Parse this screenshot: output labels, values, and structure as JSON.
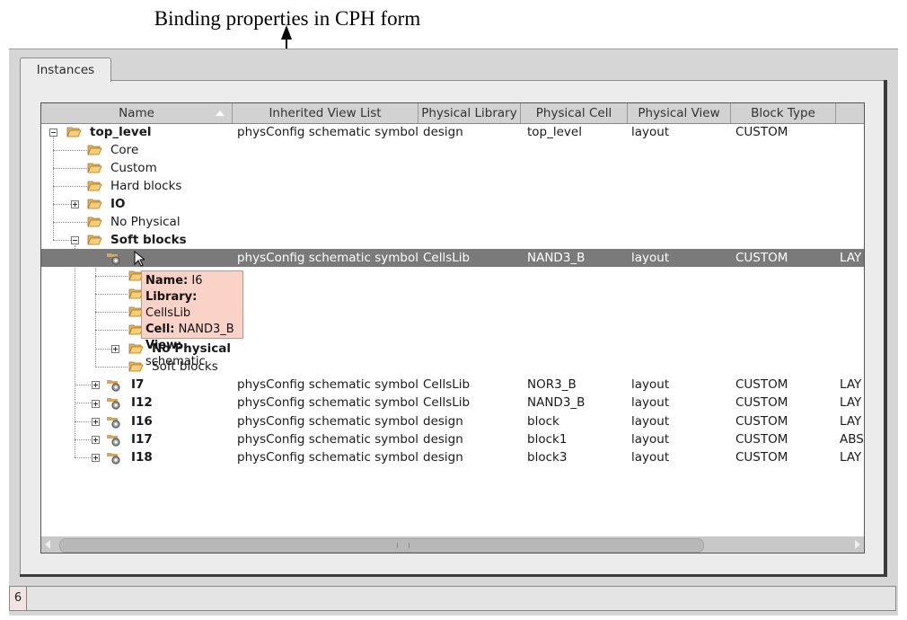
{
  "caption": "Binding properties in CPH form",
  "tab_label": "Instances",
  "columns": [
    "Name",
    "Inherited View List",
    "Physical Library",
    "Physical Cell",
    "Physical View",
    "Block Type"
  ],
  "rows": [
    {
      "name": "top_level",
      "view_list": "physConfig schematic symbol",
      "lib": "design",
      "cell": "top_level",
      "view": "layout",
      "block": "CUSTOM",
      "extra": ""
    },
    {
      "name": "Core",
      "view_list": "",
      "lib": "",
      "cell": "",
      "view": "",
      "block": "",
      "extra": ""
    },
    {
      "name": "Custom",
      "view_list": "",
      "lib": "",
      "cell": "",
      "view": "",
      "block": "",
      "extra": ""
    },
    {
      "name": "Hard blocks",
      "view_list": "",
      "lib": "",
      "cell": "",
      "view": "",
      "block": "",
      "extra": ""
    },
    {
      "name": "IO",
      "view_list": "",
      "lib": "",
      "cell": "",
      "view": "",
      "block": "",
      "extra": ""
    },
    {
      "name": "No Physical",
      "view_list": "",
      "lib": "",
      "cell": "",
      "view": "",
      "block": "",
      "extra": ""
    },
    {
      "name": "Soft blocks",
      "view_list": "",
      "lib": "",
      "cell": "",
      "view": "",
      "block": "",
      "extra": ""
    },
    {
      "name": "",
      "view_list": "physConfig schematic symbol",
      "lib": "CellsLib",
      "cell": "NAND3_B",
      "view": "layout",
      "block": "CUSTOM",
      "extra": "LAY"
    },
    {
      "name": "",
      "view_list": "",
      "lib": "",
      "cell": "",
      "view": "",
      "block": "",
      "extra": ""
    },
    {
      "name": "",
      "view_list": "",
      "lib": "",
      "cell": "",
      "view": "",
      "block": "",
      "extra": ""
    },
    {
      "name": "",
      "view_list": "",
      "lib": "",
      "cell": "",
      "view": "",
      "block": "",
      "extra": ""
    },
    {
      "name": "",
      "view_list": "",
      "lib": "",
      "cell": "",
      "view": "",
      "block": "",
      "extra": ""
    },
    {
      "name": "No Physical",
      "view_list": "",
      "lib": "",
      "cell": "",
      "view": "",
      "block": "",
      "extra": ""
    },
    {
      "name": "Soft blocks",
      "view_list": "",
      "lib": "",
      "cell": "",
      "view": "",
      "block": "",
      "extra": ""
    },
    {
      "name": "I7",
      "view_list": "physConfig schematic symbol",
      "lib": "CellsLib",
      "cell": "NOR3_B",
      "view": "layout",
      "block": "CUSTOM",
      "extra": "LAY"
    },
    {
      "name": "I12",
      "view_list": "physConfig schematic symbol",
      "lib": "CellsLib",
      "cell": "NAND3_B",
      "view": "layout",
      "block": "CUSTOM",
      "extra": "LAY"
    },
    {
      "name": "I16",
      "view_list": "physConfig schematic symbol",
      "lib": "design",
      "cell": "block",
      "view": "layout",
      "block": "CUSTOM",
      "extra": "LAY"
    },
    {
      "name": "I17",
      "view_list": "physConfig schematic symbol",
      "lib": "design",
      "cell": "block1",
      "view": "layout",
      "block": "CUSTOM",
      "extra": "ABS"
    },
    {
      "name": "I18",
      "view_list": "physConfig schematic symbol",
      "lib": "design",
      "cell": "block3",
      "view": "layout",
      "block": "CUSTOM",
      "extra": "LAY"
    }
  ],
  "tooltip": {
    "name_label": "Name:",
    "name_value": "I6",
    "lib_label": "Library:",
    "lib_value": "CellsLib",
    "cell_label": "Cell:",
    "cell_value": "NAND3_B",
    "view_label": "View:",
    "view_value": "schematic"
  },
  "status_number": "6"
}
